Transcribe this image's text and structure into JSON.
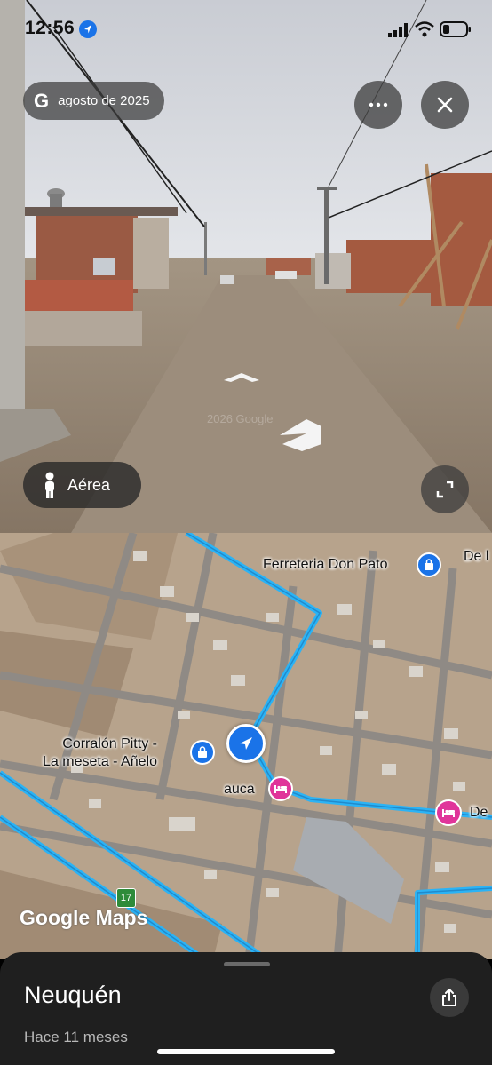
{
  "status_bar": {
    "time": "12:56"
  },
  "street_view": {
    "date_label": "agosto de 2025",
    "watermark": "2026 Google",
    "aerial_button_label": "Aérea"
  },
  "map": {
    "labels": {
      "ferreteria": "Ferreteria Don Pato",
      "de_top": "De l",
      "corralon": "Corralón Pitty -\nLa meseta - Añelo",
      "auca": "auca",
      "de_right": "De",
      "route": "17"
    },
    "logo": "Google Maps"
  },
  "bottom_sheet": {
    "place_name": "Neuquén",
    "subtitle": "Hace 11 meses"
  },
  "colors": {
    "route": "#2bb3f5",
    "accent": "#1a73e8",
    "hotel": "#e0359a"
  }
}
